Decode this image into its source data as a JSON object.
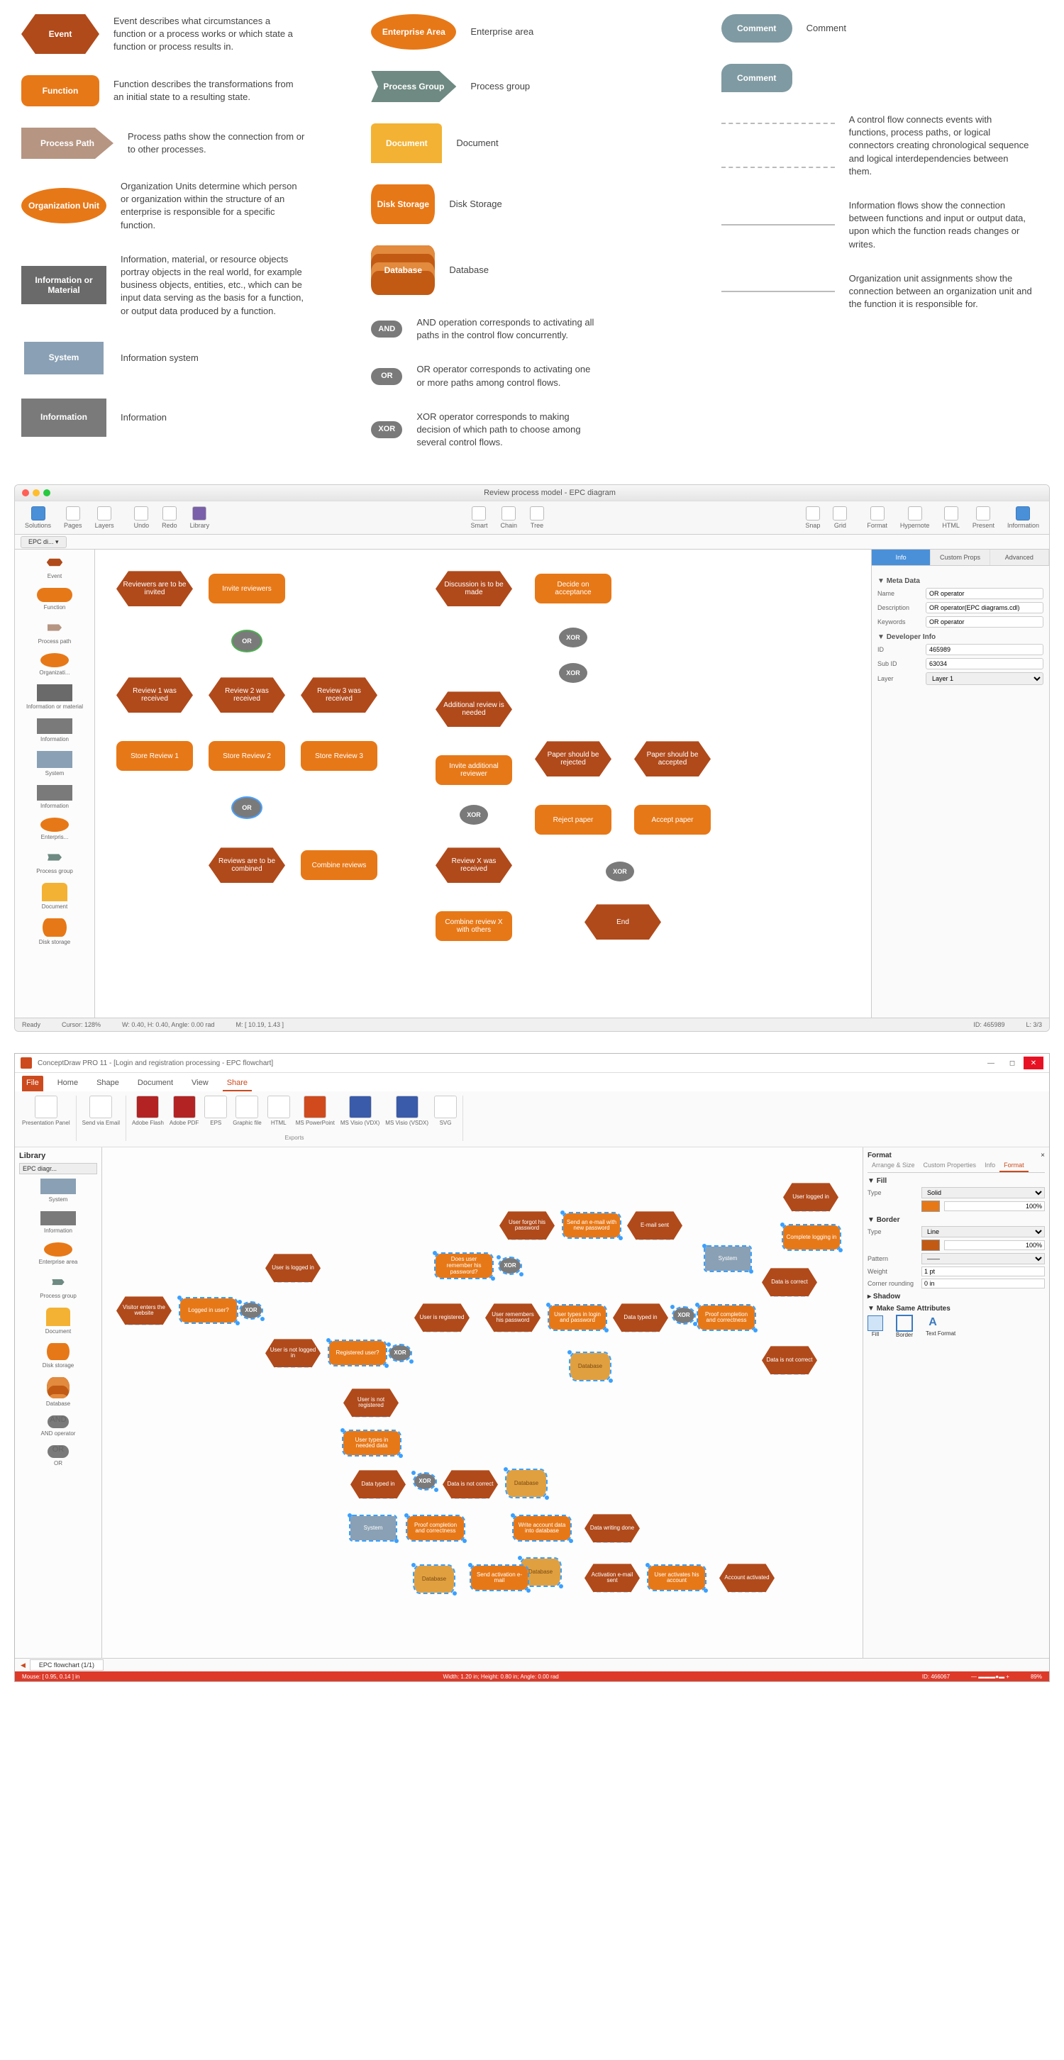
{
  "legend": {
    "col1": [
      {
        "label": "Event",
        "desc": "Event describes what circumstances a function or a process works or which state a function or process results in."
      },
      {
        "label": "Function",
        "desc": "Function describes the transformations from an initial state to a resulting state."
      },
      {
        "label": "Process Path",
        "desc": "Process paths show the connection from or to other processes."
      },
      {
        "label": "Organization Unit",
        "desc": "Organization Units determine which person or organization within the structure of an enterprise is responsible for a specific function."
      },
      {
        "label": "Information or Material",
        "desc": "Information, material, or resource objects portray objects in the real world, for example business objects, entities, etc., which can be input data serving as the basis for a function, or output data produced by a function."
      },
      {
        "label": "System",
        "desc": "Information system"
      },
      {
        "label": "Information",
        "desc": "Information"
      }
    ],
    "col2": [
      {
        "label": "Enterprise Area",
        "desc": "Enterprise area"
      },
      {
        "label": "Process Group",
        "desc": "Process group"
      },
      {
        "label": "Document",
        "desc": "Document"
      },
      {
        "label": "Disk Storage",
        "desc": "Disk Storage"
      },
      {
        "label": "Database",
        "desc": "Database"
      },
      {
        "label": "AND",
        "desc": "AND operation corresponds to activating all paths in the control flow concurrently."
      },
      {
        "label": "OR",
        "desc": "OR operator corresponds to activating one or more paths among control flows."
      },
      {
        "label": "XOR",
        "desc": "XOR operator corresponds to making decision of which path to choose among several control flows."
      }
    ],
    "col3": [
      {
        "label": "Comment",
        "desc": "Comment"
      },
      {
        "label": "Comment",
        "desc": ""
      },
      {
        "label": "",
        "desc": "A control flow connects events with functions, process paths, or logical connectors creating chronological sequence and logical interdependencies between them."
      },
      {
        "label": "",
        "desc": "Information flows show the connection between functions and input or output data, upon which the function reads changes or writes."
      },
      {
        "label": "",
        "desc": "Organization unit assignments show the connection between an organization unit and the function it is responsible for."
      }
    ]
  },
  "app1": {
    "title": "Review process model - EPC diagram",
    "toolbar": {
      "solutions": "Solutions",
      "pages": "Pages",
      "layers": "Layers",
      "undo": "Undo",
      "redo": "Redo",
      "library": "Library",
      "smart": "Smart",
      "chain": "Chain",
      "tree": "Tree",
      "snap": "Snap",
      "grid": "Grid",
      "format": "Format",
      "hypernote": "Hypernote",
      "html": "HTML",
      "present": "Present",
      "information": "Information"
    },
    "sidebar": [
      "Event",
      "Function",
      "Process path",
      "Organizati...",
      "Information or material",
      "Information",
      "System",
      "Information",
      "Enterpris...",
      "Process group",
      "Document",
      "Disk storage"
    ],
    "nodes": {
      "e1": "Reviewers are to be invited",
      "f1": "Invite reviewers",
      "op1": "OR",
      "e2": "Review 1 was received",
      "e3": "Review 2 was received",
      "e4": "Review 3 was received",
      "f2": "Store Review 1",
      "f3": "Store Review 2",
      "f4": "Store Review 3",
      "op2": "OR",
      "e5": "Reviews are to be combined",
      "f5": "Combine reviews",
      "e6": "Discussion is to be made",
      "f6": "Decide on acceptance",
      "op3": "XOR",
      "op4": "XOR",
      "e7": "Additional review is needed",
      "f7": "Invite additional reviewer",
      "op5": "XOR",
      "e8": "Review X was received",
      "f8": "Combine review X with others",
      "e9": "Paper should be rejected",
      "e10": "Paper should be accepted",
      "f9": "Reject paper",
      "f10": "Accept paper",
      "op6": "XOR",
      "e11": "End"
    },
    "inspector": {
      "tabs": [
        "Info",
        "Custom Props",
        "Advanced"
      ],
      "section1": "Meta Data",
      "name_lbl": "Name",
      "name_val": "OR operator",
      "desc_lbl": "Description",
      "desc_val": "OR operator(EPC diagrams.cdl)",
      "kw_lbl": "Keywords",
      "kw_val": "OR operator",
      "section2": "Developer Info",
      "id_lbl": "ID",
      "id_val": "465989",
      "sub_lbl": "Sub ID",
      "sub_val": "63034",
      "layer_lbl": "Layer",
      "layer_val": "Layer 1"
    },
    "statusbar": {
      "ready": "Ready",
      "cursor": "Cursor: 128%",
      "wh": "W: 0.40, H: 0.40, Angle: 0.00 rad",
      "m": "M: [ 10.19, 1.43 ]",
      "id": "ID: 465989",
      "l": "L: 3/3"
    }
  },
  "app2": {
    "title": "ConceptDraw PRO 11 - [Login and registration processing - EPC flowchart]",
    "tabs": [
      "File",
      "Home",
      "Shape",
      "Document",
      "View",
      "Share"
    ],
    "ribbon": {
      "presentation": "Presentation Panel",
      "send": "Send via Email",
      "flash": "Adobe Flash",
      "pdf": "Adobe PDF",
      "eps": "EPS",
      "graphic": "Graphic file",
      "html": "HTML",
      "ppt": "MS PowerPoint",
      "visio1": "MS Visio (VDX)",
      "visio2": "MS Visio (VSDX)",
      "svg": "SVG",
      "exports_lbl": "Exports"
    },
    "sidebar_title": "Library",
    "sidebar_tab": "EPC diagr...",
    "sidebar": [
      "System",
      "Information",
      "Enterprise area",
      "Process group",
      "Document",
      "Disk storage",
      "Database",
      "AND operator",
      "OR"
    ],
    "nodes": {
      "e1": "Visitor enters the website",
      "f1": "Logged in user?",
      "op1": "XOR",
      "e2": "User is logged in",
      "e3": "User is not logged in",
      "f2": "Registered user?",
      "op2": "XOR",
      "e4": "User is registered",
      "e5": "User is not registered",
      "f3": "User types in needed data",
      "op3": "XOR",
      "e6": "Data typed in",
      "e7": "Data is not correct",
      "f4": "Does user remember his password?",
      "op4": "XOR",
      "e8": "User forgot his password",
      "f5": "Send an e-mail with new password",
      "e9": "E-mail sent",
      "e10": "User remembers his password",
      "f6": "User types in login and password",
      "e11": "Data typed in",
      "op5": "XOR",
      "f7": "Proof completion and correctness",
      "e12": "Data is correct",
      "e13": "Data is not correct",
      "f8": "Complete logging in",
      "e14": "User logged in",
      "sys1": "System",
      "db1": "Database",
      "sys2": "System",
      "f9": "Proof completion and correctness",
      "db2": "Database",
      "f10": "Write account data into database",
      "e15": "Data writing done",
      "db3": "Database",
      "f11": "Send activation e-mail",
      "e16": "Activation e-mail sent",
      "f12": "User activates his account",
      "e17": "Account activated"
    },
    "format": {
      "panel_title": "Format",
      "close": "×",
      "tabs": [
        "Arrange & Size",
        "Custom Properties",
        "Info",
        "Format"
      ],
      "fill_title": "Fill",
      "fill_type_lbl": "Type",
      "fill_type_val": "Solid",
      "fill_pct": "100%",
      "border_title": "Border",
      "b_type_lbl": "Type",
      "b_type_val": "Line",
      "b_pct": "100%",
      "pattern_lbl": "Pattern",
      "weight_lbl": "Weight",
      "weight_val": "1 pt",
      "corner_lbl": "Corner rounding",
      "corner_val": "0 in",
      "shadow_title": "Shadow",
      "same_title": "Make Same Attributes",
      "sa1": "Fill",
      "sa2": "Border",
      "sa3": "Text Format"
    },
    "bottom_tab": "EPC flowchart (1/1)",
    "statusbar": {
      "mouse": "Mouse: [ 0.95, 0.14 ] in",
      "width": "Width: 1.20 in; Height: 0.80 in; Angle: 0.00 rad",
      "id": "ID: 466067",
      "zoom": "89%"
    }
  }
}
